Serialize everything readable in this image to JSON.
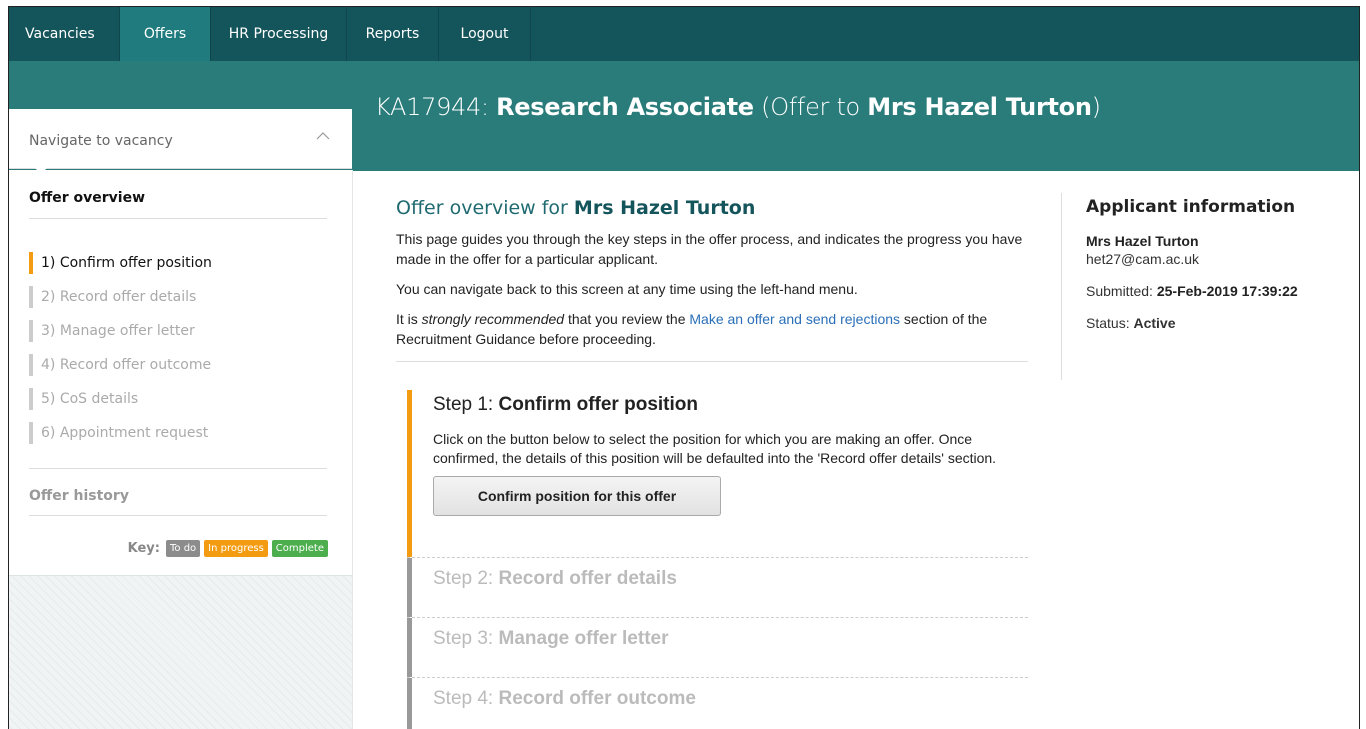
{
  "nav": {
    "items": [
      {
        "label": "Vacancies"
      },
      {
        "label": "Offers"
      },
      {
        "label": "HR Processing"
      },
      {
        "label": "Reports"
      },
      {
        "label": "Logout"
      }
    ],
    "active": "Offers"
  },
  "header": {
    "ref": "KA17944:",
    "job": "Research Associate",
    "offer_prefix": "(Offer to",
    "applicant": "Mrs Hazel Turton",
    "offer_suffix": ")"
  },
  "sidebar": {
    "navigate_label": "Navigate to vacancy",
    "navigate_icon": "chevron-up-icon",
    "title": "Offer overview",
    "steps": [
      {
        "label": "1) Confirm offer position",
        "state": "in-progress"
      },
      {
        "label": "2) Record offer details",
        "state": "to-do"
      },
      {
        "label": "3) Manage offer letter",
        "state": "to-do"
      },
      {
        "label": "4) Record offer outcome",
        "state": "to-do"
      },
      {
        "label": "5) CoS details",
        "state": "to-do"
      },
      {
        "label": "6) Appointment request",
        "state": "to-do"
      }
    ],
    "history_label": "Offer history",
    "key": {
      "label": "Key:",
      "todo": "To do",
      "in_progress": "In progress",
      "complete": "Complete"
    }
  },
  "main": {
    "heading_prefix": "Offer overview for",
    "heading_name": "Mrs Hazel Turton",
    "p1": "This page guides you through the key steps in the offer process, and indicates the progress you have made in the offer for a particular applicant.",
    "p2": "You can navigate back to this screen at any time using the left-hand menu.",
    "p3_a": "It is",
    "p3_em": "strongly recommended",
    "p3_b": "that you review the",
    "p3_link": "Make an offer and send rejections",
    "p3_c": "section of the Recruitment Guidance before proceeding.",
    "steps": [
      {
        "prefix": "Step 1:",
        "title": "Confirm offer position",
        "body": "Click on the button below to select the position for which you are making an offer. Once confirmed, the details of this position will be defaulted into the 'Record offer details' section.",
        "button": "Confirm position for this offer"
      },
      {
        "prefix": "Step 2:",
        "title": "Record offer details"
      },
      {
        "prefix": "Step 3:",
        "title": "Manage offer letter"
      },
      {
        "prefix": "Step 4:",
        "title": "Record offer outcome"
      }
    ]
  },
  "applicant": {
    "heading": "Applicant information",
    "name": "Mrs Hazel Turton",
    "email": "het27@cam.ac.uk",
    "submitted_label": "Submitted:",
    "submitted_value": "25-Feb-2019 17:39:22",
    "status_label": "Status:",
    "status_value": "Active"
  },
  "colors": {
    "nav_bg": "#14545b",
    "nav_active": "#1f7b7e",
    "banner": "#2a7c7b",
    "in_progress": "#f39c12",
    "complete": "#4cae4c",
    "todo": "#8c8c8c",
    "link": "#2a6fb8"
  }
}
